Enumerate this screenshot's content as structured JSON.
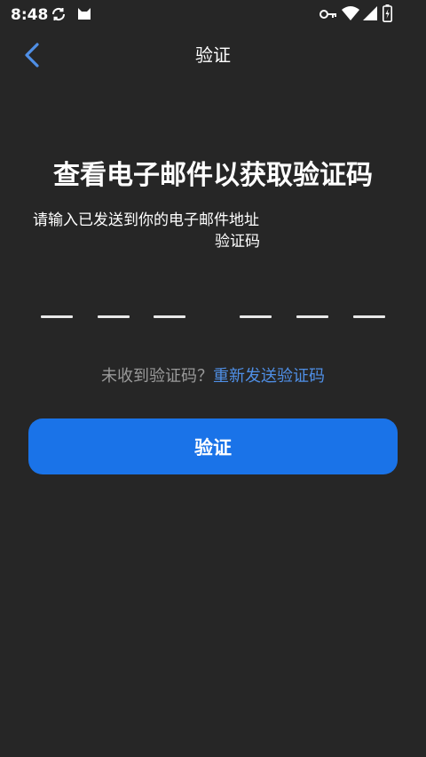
{
  "status_bar": {
    "time": "8:48",
    "icons": [
      "sync-icon",
      "cat-icon",
      "key-icon",
      "wifi-icon",
      "signal-icon",
      "battery-icon"
    ]
  },
  "header": {
    "title": "验证",
    "back_icon": "chevron-left-icon"
  },
  "main": {
    "headline": "查看电子邮件以获取验证码",
    "instruction": "请输入已发送到你的电子邮件地址",
    "instruction_tail": "验证码",
    "code_slots": 6,
    "resend_question": "未收到验证码？",
    "resend_link": "重新发送验证码",
    "verify_button": "验证"
  },
  "colors": {
    "background": "#262626",
    "accent": "#1a73e8",
    "link": "#4f8fe6",
    "muted_text": "#9a9a9a"
  }
}
